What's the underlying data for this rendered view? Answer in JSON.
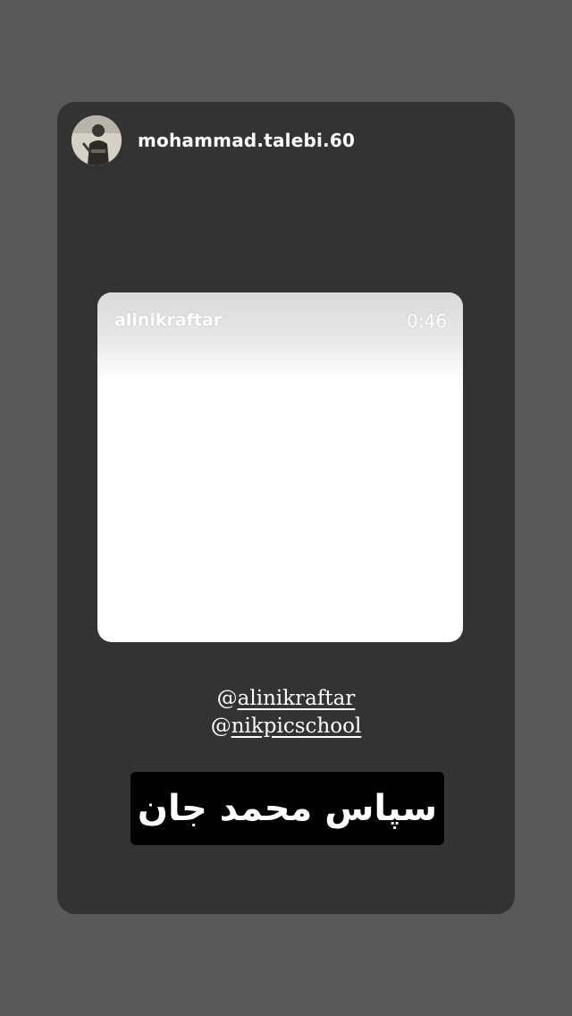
{
  "story": {
    "username": "mohammad.talebi.60",
    "avatar_icon": "profile-photo",
    "media": {
      "username": "alinikraftar",
      "duration": "0:46"
    },
    "mentions": [
      {
        "at": "@",
        "handle": "alinikraftar"
      },
      {
        "at": "@",
        "handle": "nikpicschool"
      }
    ],
    "caption": "سپاس محمد جان"
  },
  "colors": {
    "background": "#595959",
    "card": "#333333",
    "caption_box": "#000000",
    "text": "#ffffff"
  }
}
